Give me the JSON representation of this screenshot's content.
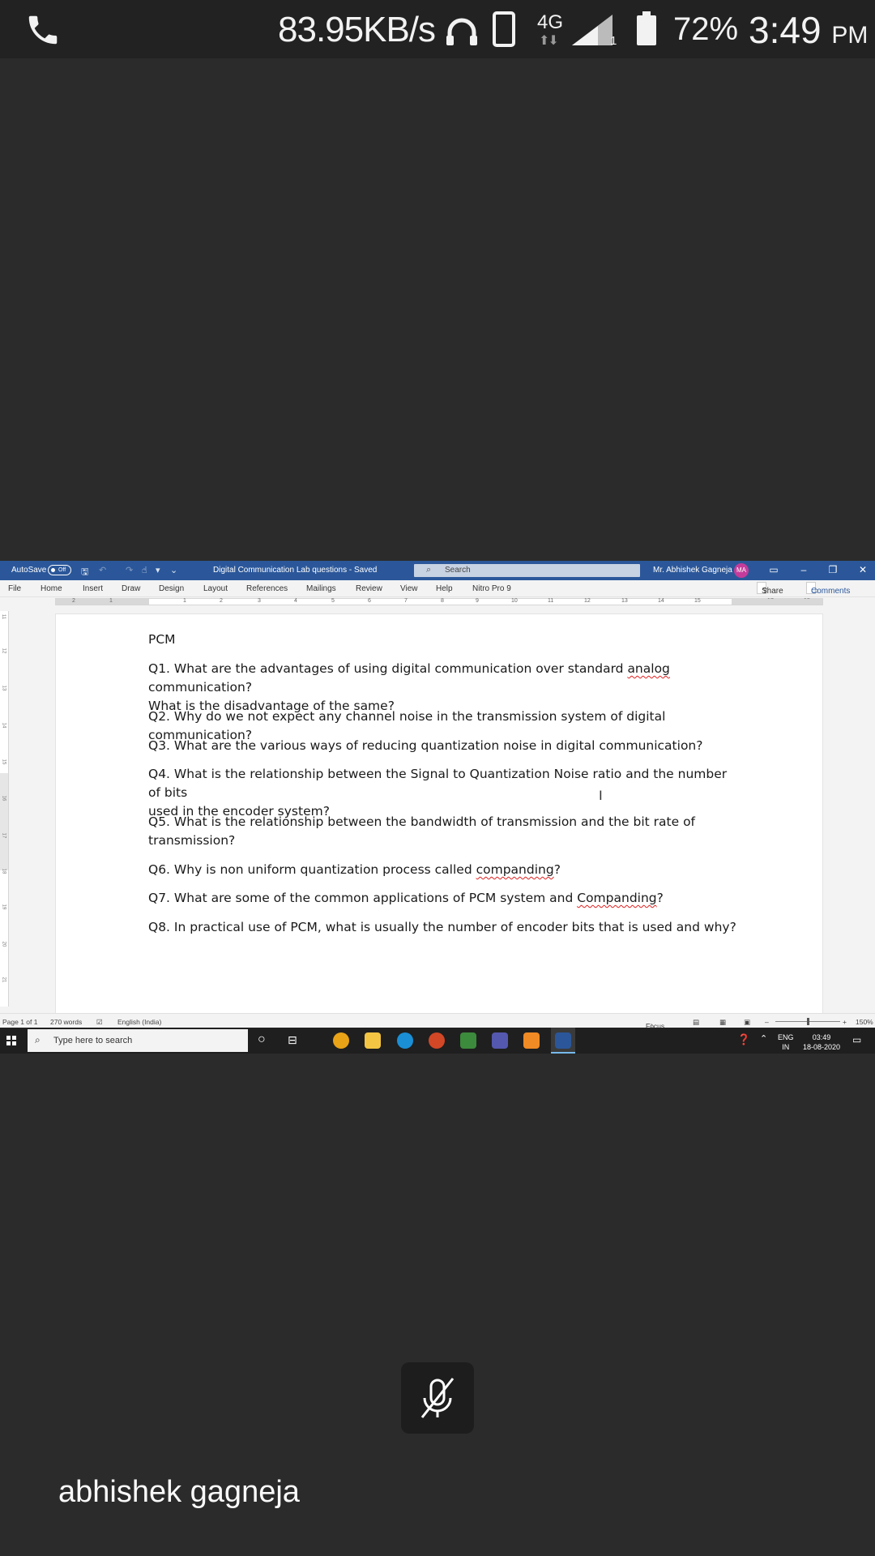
{
  "status_bar": {
    "network_speed": "83.95KB/s",
    "network_type": "4G",
    "sim_slot": "1",
    "battery_percent": "72%",
    "time": "3:49",
    "ampm": "PM",
    "icons": [
      "phone-icon",
      "headset-icon",
      "device-icon",
      "signal-icon",
      "battery-icon"
    ]
  },
  "word": {
    "titlebar": {
      "autosave_label": "AutoSave",
      "autosave_state": "Off",
      "document_title": "Digital Communication Lab questions  -  Saved",
      "search_placeholder": "Search",
      "user_name": "Mr. Abhishek Gagneja",
      "user_initials": "MA",
      "accent_color": "#2b579a"
    },
    "ribbon_tabs": [
      "File",
      "Home",
      "Insert",
      "Draw",
      "Design",
      "Layout",
      "References",
      "Mailings",
      "Review",
      "View",
      "Help",
      "Nitro Pro 9"
    ],
    "share_label": "Share",
    "comments_label": "Comments",
    "ruler_numbers": [
      "2",
      "1",
      "1",
      "2",
      "3",
      "4",
      "5",
      "6",
      "7",
      "8",
      "9",
      "10",
      "11",
      "12",
      "13",
      "14",
      "15",
      "17",
      "18"
    ],
    "vertical_ruler_numbers": [
      "11",
      "12",
      "13",
      "14",
      "15",
      "16",
      "17",
      "18",
      "19",
      "20",
      "21"
    ],
    "document": {
      "heading": "PCM",
      "questions": [
        {
          "pre": "Q1. What are the advantages of using digital communication over standard ",
          "flag": "analog",
          "post": " communication?",
          "line2": "What is the disadvantage of the same?"
        },
        {
          "pre": "Q2. Why do we not expect any channel noise in the transmission system of digital communication?",
          "flag": "",
          "post": "",
          "line2": ""
        },
        {
          "pre": "Q3. What are the various ways of reducing quantization noise in digital communication?",
          "flag": "",
          "post": "",
          "line2": ""
        },
        {
          "pre": "Q4. What is the relationship between the Signal to Quantization Noise ratio and the number of bits",
          "flag": "",
          "post": "",
          "line2": "used in the encoder system?"
        },
        {
          "pre": "Q5. What is the relationship between the bandwidth of transmission and the bit rate of",
          "flag": "",
          "post": "",
          "line2": "transmission?"
        },
        {
          "pre": "Q6. Why is non uniform quantization process called ",
          "flag": "companding",
          "post": "?",
          "line2": ""
        },
        {
          "pre": "Q7. What are some of the common applications of PCM system and ",
          "flag": "Companding",
          "post": "?",
          "line2": ""
        },
        {
          "pre": "Q8. In practical use of PCM, what is usually the number of encoder bits that is used and why?",
          "flag": "",
          "post": "",
          "line2": ""
        }
      ]
    },
    "status": {
      "page": "Page 1 of 1",
      "words": "270 words",
      "language": "English (India)",
      "focus": "Focus",
      "zoom": "150%",
      "zoom_fraction": 0.5
    },
    "taskbar": {
      "search_placeholder": "Type here to search",
      "lang_top": "ENG",
      "lang_bottom": "IN",
      "time": "03:49",
      "date": "18-08-2020",
      "app_colors": [
        "#e8a317",
        "#f4c542",
        "#1a8fd6",
        "#d24726",
        "#3c8a3c",
        "#5558af",
        "#f08a24",
        "#2b579a"
      ]
    }
  },
  "call": {
    "mic_state": "muted",
    "presenter_name": "abhishek gagneja"
  }
}
